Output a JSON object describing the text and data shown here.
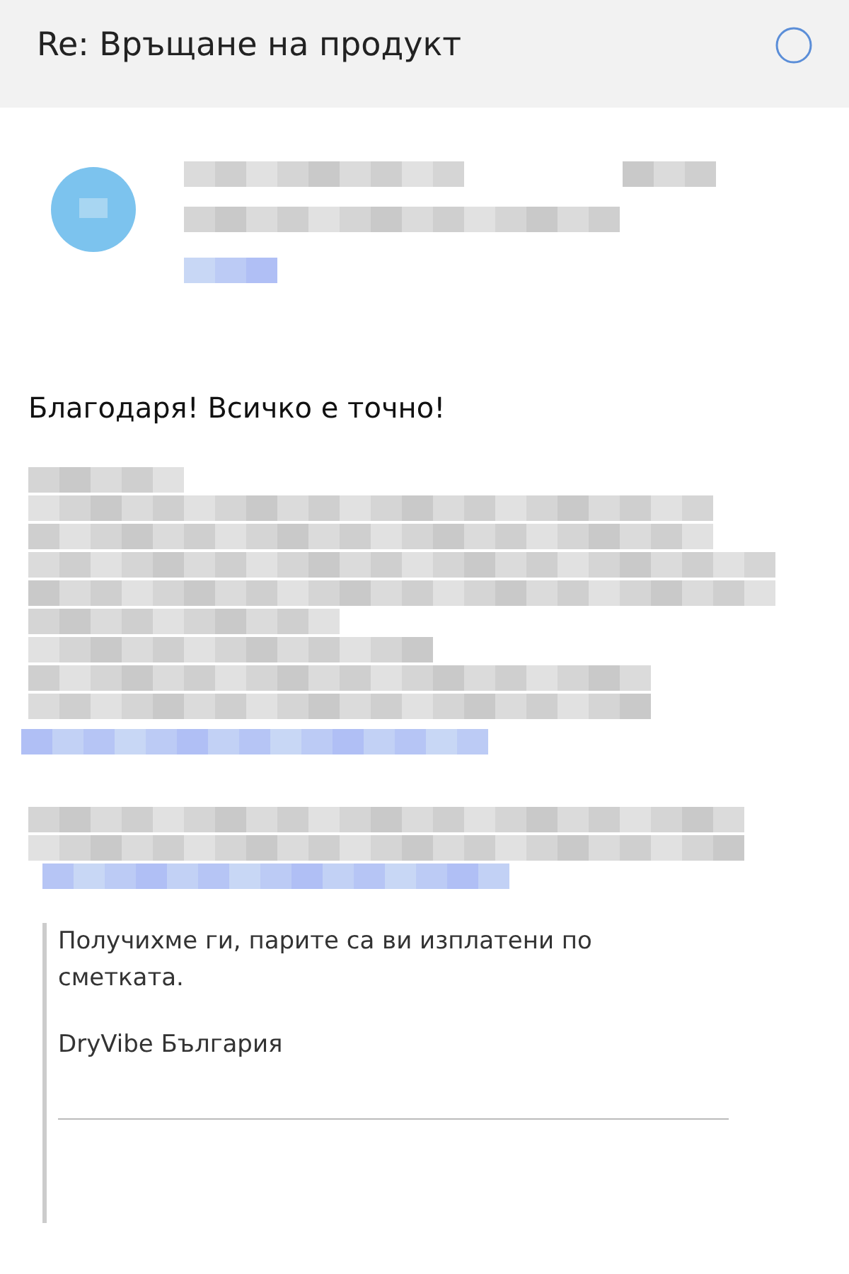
{
  "header": {
    "title": "Re: Връщане на продукт"
  },
  "message": {
    "body": "Благодаря! Всичко е точно!"
  },
  "quote": {
    "lines": [
      "Получихме ги, парите са ви изплатени по сметката."
    ],
    "signature": "DryVibe България"
  }
}
